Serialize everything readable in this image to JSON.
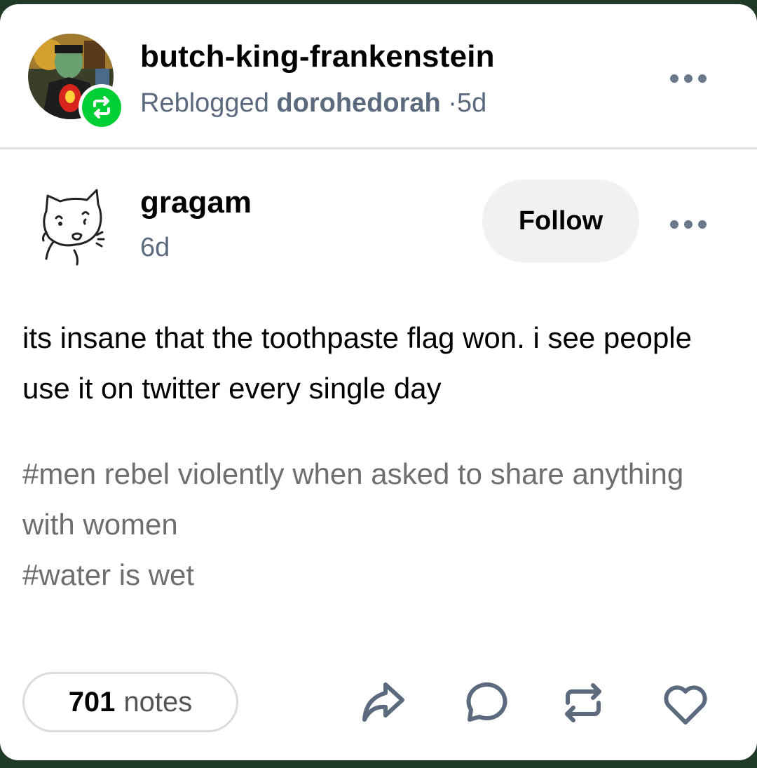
{
  "reblog": {
    "username": "butch-king-frankenstein",
    "reblogged_label": "Reblogged",
    "source_blog": "dorohedorah",
    "separator": "·",
    "time": "5d"
  },
  "post": {
    "username": "gragam",
    "time": "6d",
    "follow_label": "Follow",
    "body": "its insane that the toothpaste flag won. i see people use it on twitter every single day",
    "tags": [
      "#men rebel violently when asked to share anything with women",
      "#water is wet"
    ]
  },
  "footer": {
    "notes_count": "701",
    "notes_label": "notes",
    "actions": [
      "share-icon",
      "reply-icon",
      "reblog-icon",
      "like-icon"
    ]
  },
  "colors": {
    "reblog_green": "#00cf35",
    "secondary_text": "#5b6a7d",
    "tag_text": "#6e6e6e",
    "follow_bg": "#f0f1f3"
  }
}
